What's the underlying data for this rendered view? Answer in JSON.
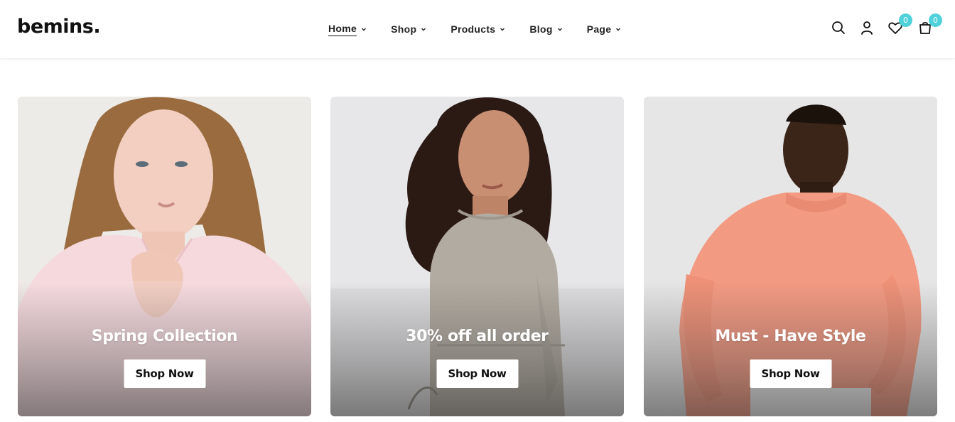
{
  "brand": {
    "logo": "bemins."
  },
  "nav": {
    "items": [
      {
        "label": "Home",
        "active": true
      },
      {
        "label": "Shop",
        "active": false
      },
      {
        "label": "Products",
        "active": false
      },
      {
        "label": "Blog",
        "active": false
      },
      {
        "label": "Page",
        "active": false
      }
    ]
  },
  "header_icons": {
    "wishlist_count": "0",
    "cart_count": "0",
    "badge_color": "#4fd1d9"
  },
  "cards": [
    {
      "title": "Spring Collection",
      "button": "Shop Now"
    },
    {
      "title": "30% off all order",
      "button": "Shop Now"
    },
    {
      "title": "Must - Have Style",
      "button": "Shop Now"
    }
  ]
}
